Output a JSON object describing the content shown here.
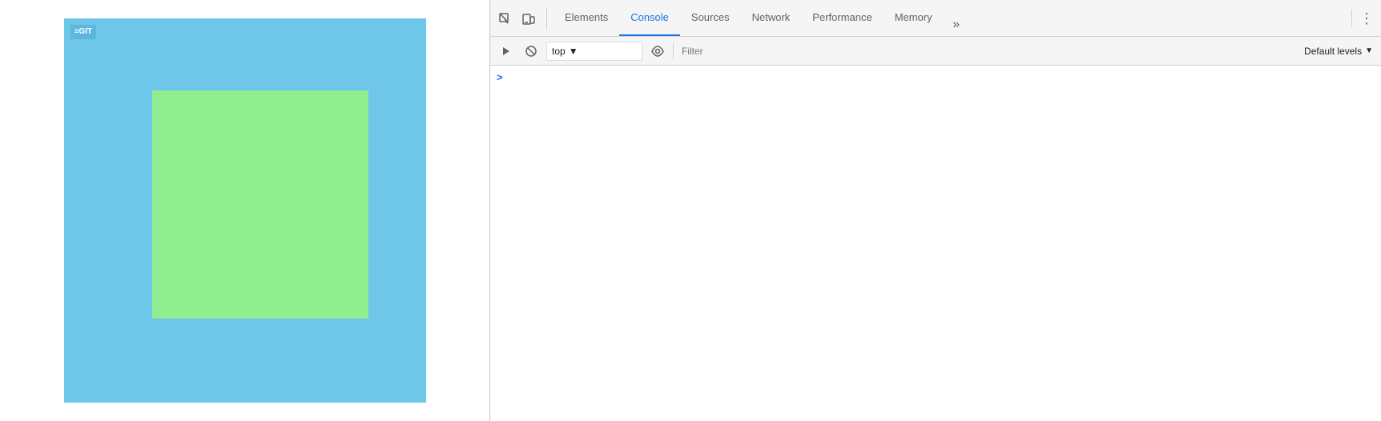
{
  "left_panel": {
    "logo_text": "≡GIT",
    "bg_color": "#6ec6e8",
    "green_box_color": "#90ee90"
  },
  "devtools": {
    "tabs": [
      {
        "label": "Elements",
        "active": false
      },
      {
        "label": "Console",
        "active": true
      },
      {
        "label": "Sources",
        "active": false
      },
      {
        "label": "Network",
        "active": false
      },
      {
        "label": "Performance",
        "active": false
      },
      {
        "label": "Memory",
        "active": false
      }
    ],
    "more_tabs_label": "»",
    "menu_dots": "⋮",
    "console": {
      "context_value": "top",
      "filter_placeholder": "Filter",
      "default_levels_label": "Default levels",
      "prompt_symbol": ">"
    }
  }
}
